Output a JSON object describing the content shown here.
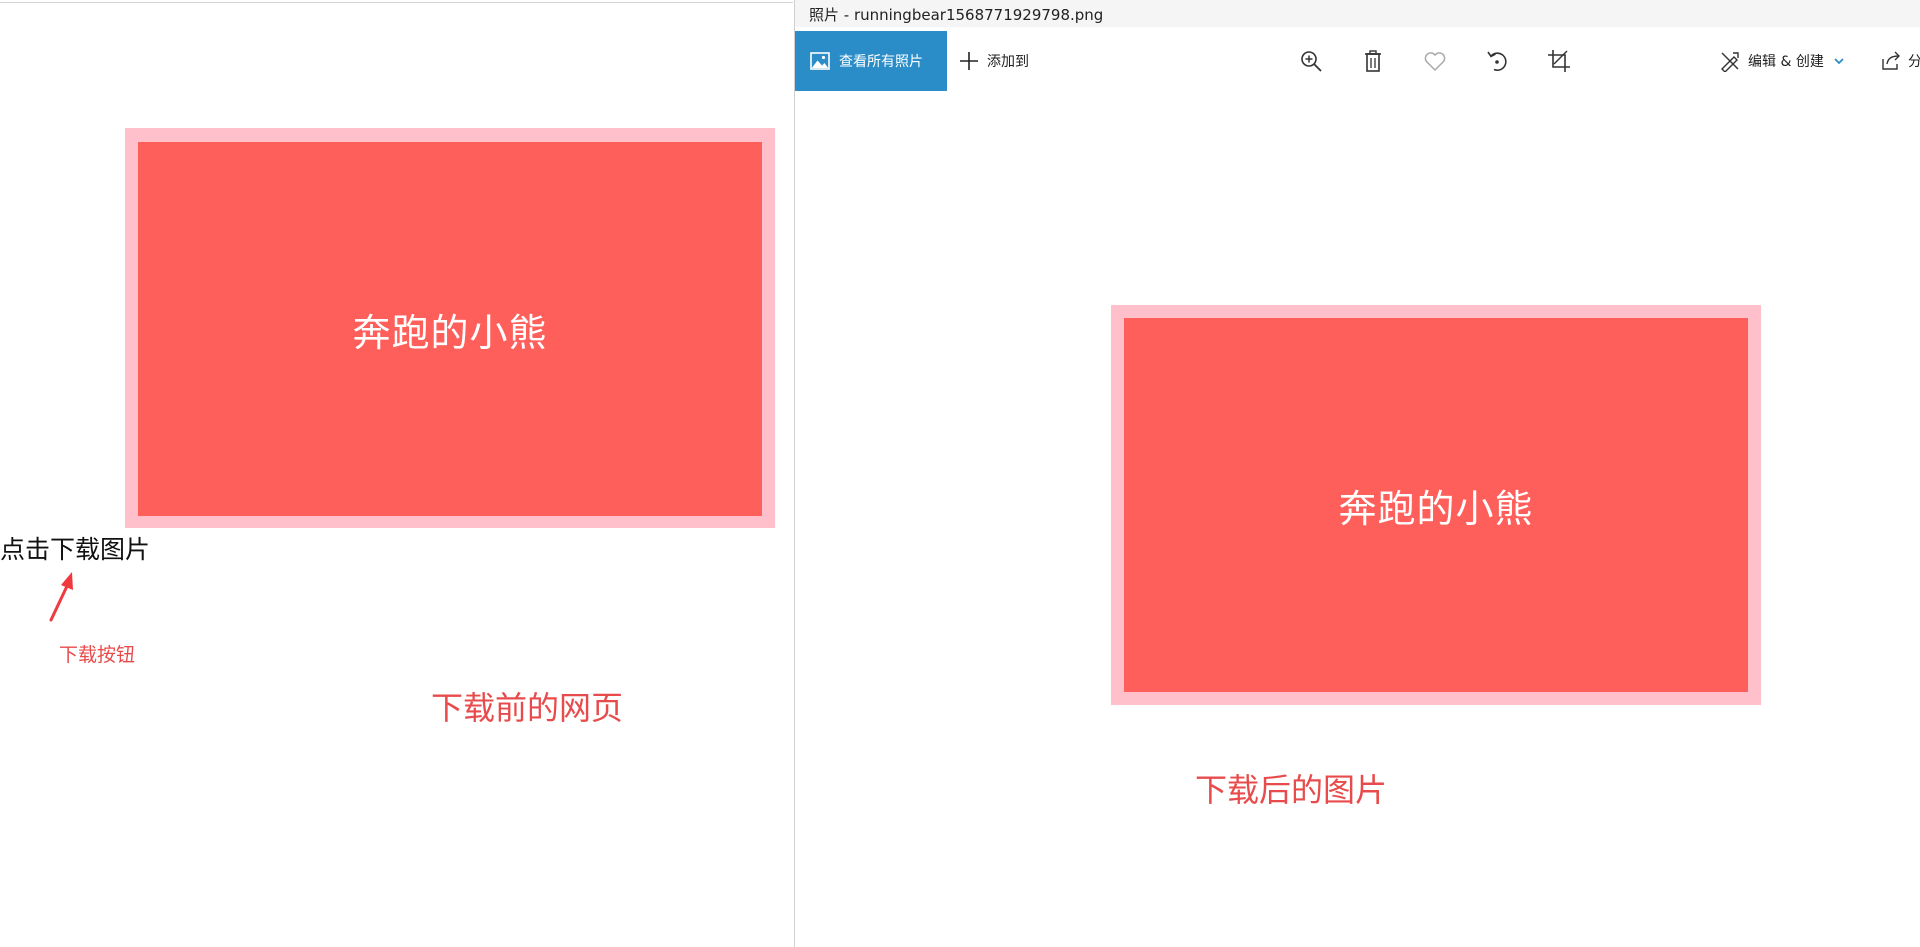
{
  "left_page": {
    "canvas_text": "奔跑的小熊",
    "download_link": "点击下载图片",
    "note_button": "下载按钮",
    "note_before": "下载前的网页"
  },
  "photos_app": {
    "title": "照片 - runningbear1568771929798.png",
    "toolbar": {
      "view_all": "查看所有照片",
      "add_to": "添加到",
      "edit_create": "编辑 & 创建",
      "share": "分"
    },
    "image_text": "奔跑的小熊",
    "note_after": "下载后的图片"
  },
  "colors": {
    "canvas_border": "#ffc0cb",
    "canvas_fill": "#ff5f5b",
    "annotation": "#e84b4b",
    "accent": "#2a8dc8"
  },
  "icons": [
    "image-icon",
    "plus-icon",
    "zoom-in-icon",
    "delete-icon",
    "heart-icon",
    "rotate-icon",
    "crop-icon",
    "edit-create-icon",
    "chevron-down-icon",
    "share-icon",
    "arrow-annotation-icon"
  ]
}
